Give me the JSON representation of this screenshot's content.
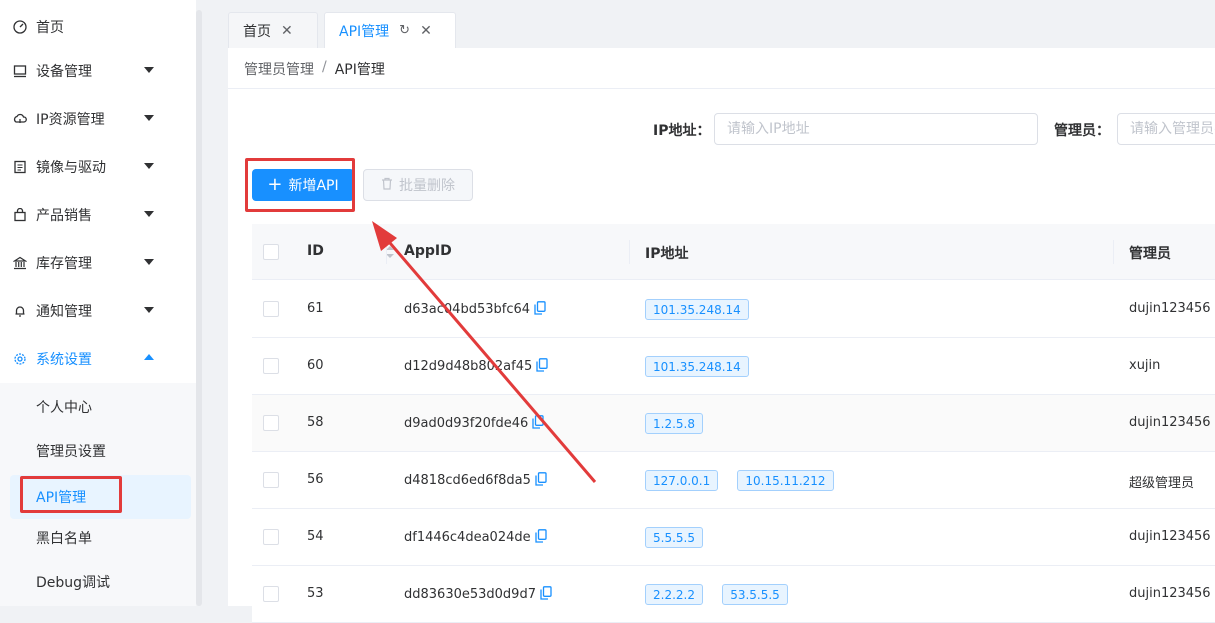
{
  "sidebar": {
    "items": [
      {
        "label": "首页",
        "icon": "dashboard-icon",
        "hasCaret": false
      },
      {
        "label": "设备管理",
        "icon": "monitor-icon",
        "hasCaret": true
      },
      {
        "label": "IP资源管理",
        "icon": "cloud-icon",
        "hasCaret": true
      },
      {
        "label": "镜像与驱动",
        "icon": "document-icon",
        "hasCaret": true
      },
      {
        "label": "产品销售",
        "icon": "bag-icon",
        "hasCaret": true
      },
      {
        "label": "库存管理",
        "icon": "bank-icon",
        "hasCaret": true
      },
      {
        "label": "通知管理",
        "icon": "bell-icon",
        "hasCaret": true
      },
      {
        "label": "系统设置",
        "icon": "gear-icon",
        "hasCaret": true,
        "active": true
      }
    ],
    "submenu": [
      {
        "label": "个人中心"
      },
      {
        "label": "管理员设置"
      },
      {
        "label": "API管理",
        "active": true
      },
      {
        "label": "黑白名单"
      },
      {
        "label": "Debug调试"
      }
    ]
  },
  "tabs": [
    {
      "label": "首页"
    },
    {
      "label": "API管理",
      "active": true
    }
  ],
  "breadcrumb": {
    "parent": "管理员管理",
    "separator": "/",
    "current": "API管理"
  },
  "filters": {
    "ip_label": "IP地址：",
    "ip_placeholder": "请输入IP地址",
    "admin_label": "管理员：",
    "admin_placeholder": "请输入管理员名"
  },
  "toolbar": {
    "add_label": "新增API",
    "delete_label": "批量删除"
  },
  "table": {
    "headers": {
      "id": "ID",
      "appid": "AppID",
      "ip": "IP地址",
      "admin": "管理员"
    },
    "rows": [
      {
        "id": "61",
        "appid": "d63ac04bd53bfc64",
        "ips": [
          "101.35.248.14"
        ],
        "admin": "dujin123456"
      },
      {
        "id": "60",
        "appid": "d12d9d48b802af45",
        "ips": [
          "101.35.248.14"
        ],
        "admin": "xujin"
      },
      {
        "id": "58",
        "appid": "d9ad0d93f20fde46",
        "ips": [
          "1.2.5.8"
        ],
        "admin": "dujin123456"
      },
      {
        "id": "56",
        "appid": "d4818cd6ed6f8da5",
        "ips": [
          "127.0.0.1",
          "10.15.11.212"
        ],
        "admin": "超级管理员"
      },
      {
        "id": "54",
        "appid": "df1446c4dea024de",
        "ips": [
          "5.5.5.5"
        ],
        "admin": "dujin123456"
      },
      {
        "id": "53",
        "appid": "dd83630e53d0d9d7",
        "ips": [
          "2.2.2.2",
          "53.5.5.5"
        ],
        "admin": "dujin123456"
      }
    ]
  },
  "colors": {
    "accent": "#1890ff",
    "highlight": "#e23b3b"
  }
}
